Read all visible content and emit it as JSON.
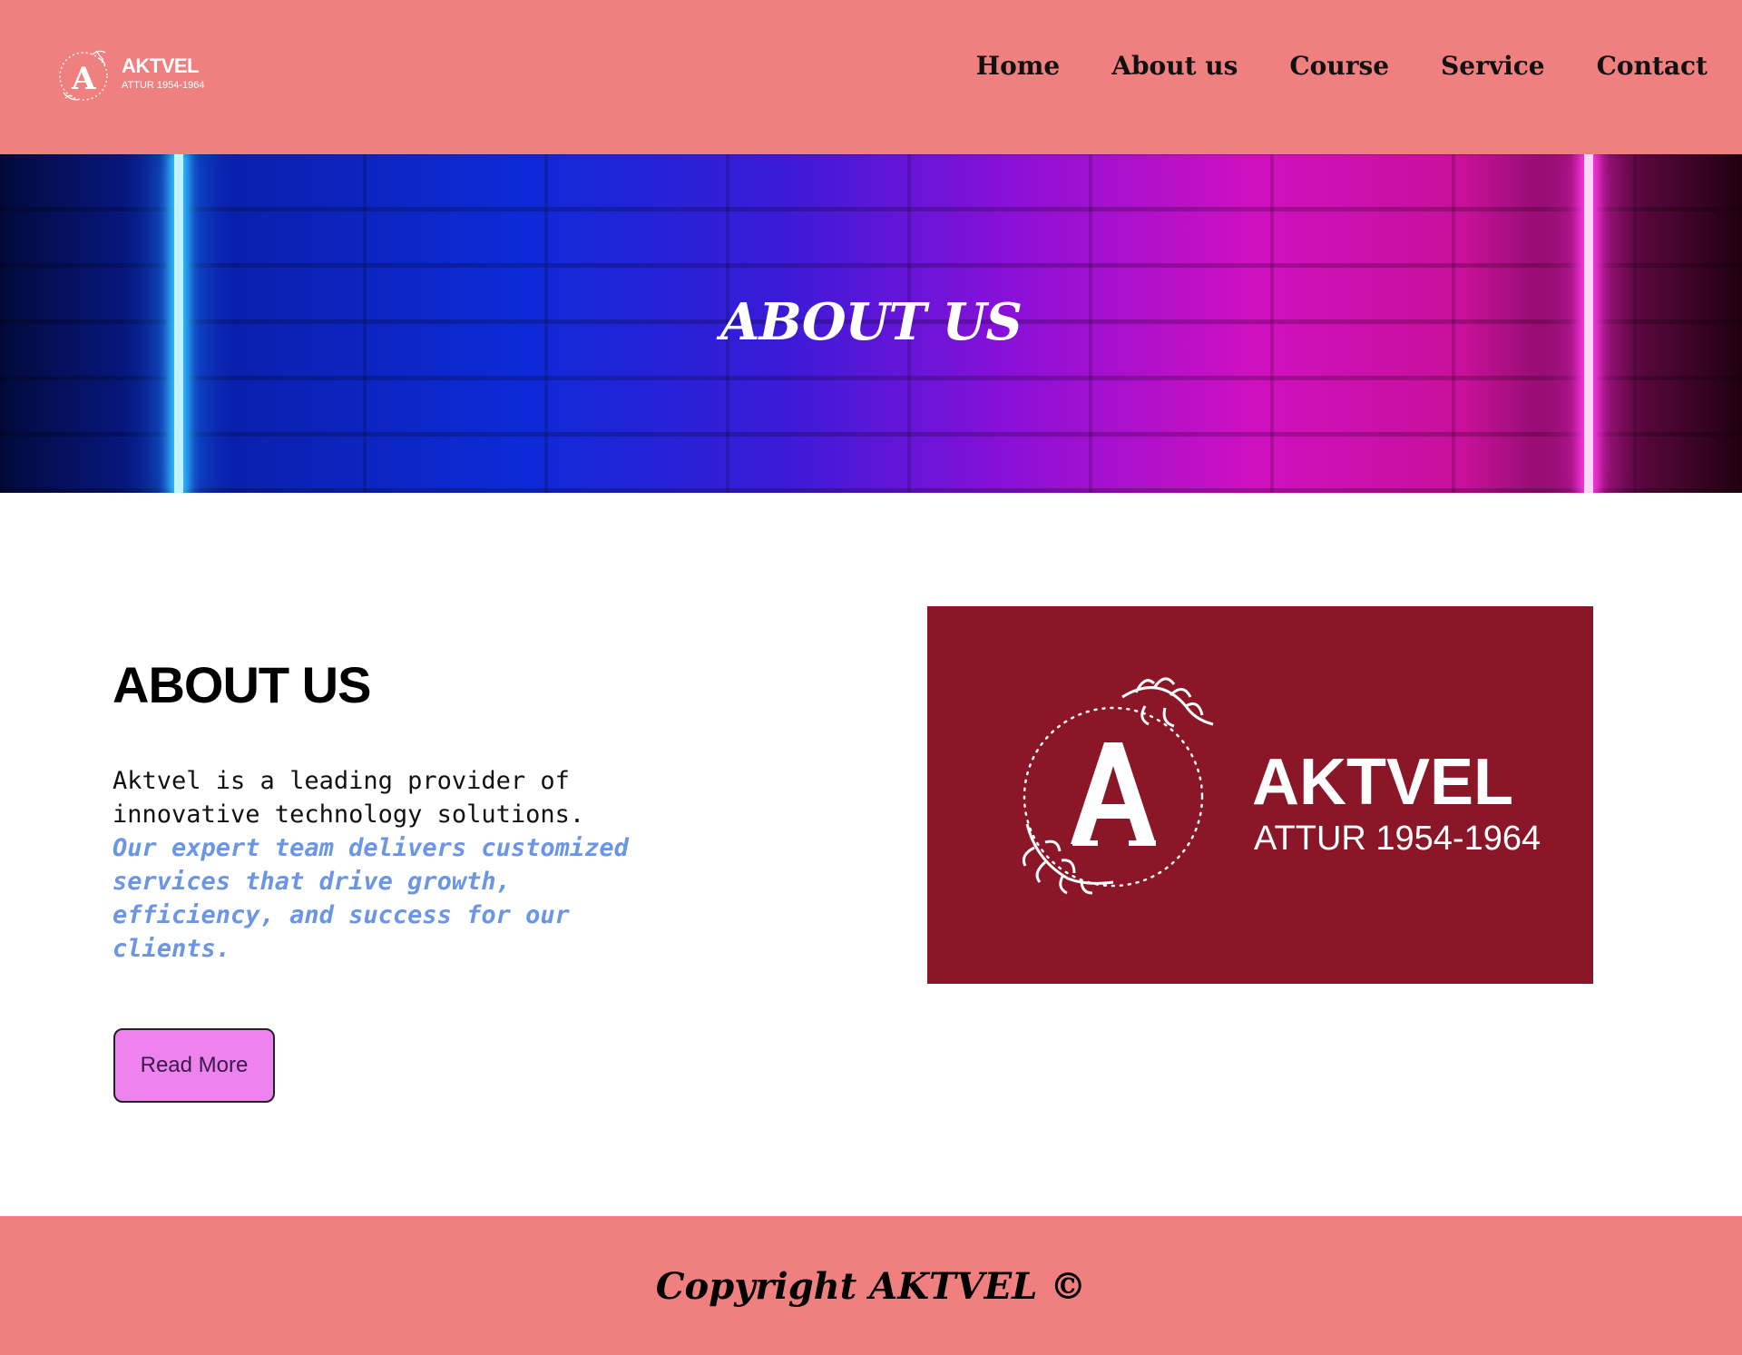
{
  "brand": {
    "name": "AKTVEL",
    "tagline": "ATTUR 1954-1964"
  },
  "nav": {
    "items": [
      {
        "label": "Home"
      },
      {
        "label": "About us"
      },
      {
        "label": "Course"
      },
      {
        "label": "Service"
      },
      {
        "label": "Contact"
      }
    ]
  },
  "hero": {
    "title": "ABOUT US"
  },
  "about": {
    "heading": "ABOUT US",
    "text_plain": "Aktvel is a leading provider of innovative technology solutions.",
    "text_highlight": "Our expert team delivers customized services that drive growth, efficiency, and success for our clients.",
    "button_label": "Read More"
  },
  "footer": {
    "copyright": "Copyright AKTVEL ©"
  },
  "colors": {
    "header_bg": "#f08080",
    "footer_bg": "#f08080",
    "highlight_text": "#6b95e6",
    "button_bg": "#ee82ee",
    "image_bg": "#8b1628"
  }
}
